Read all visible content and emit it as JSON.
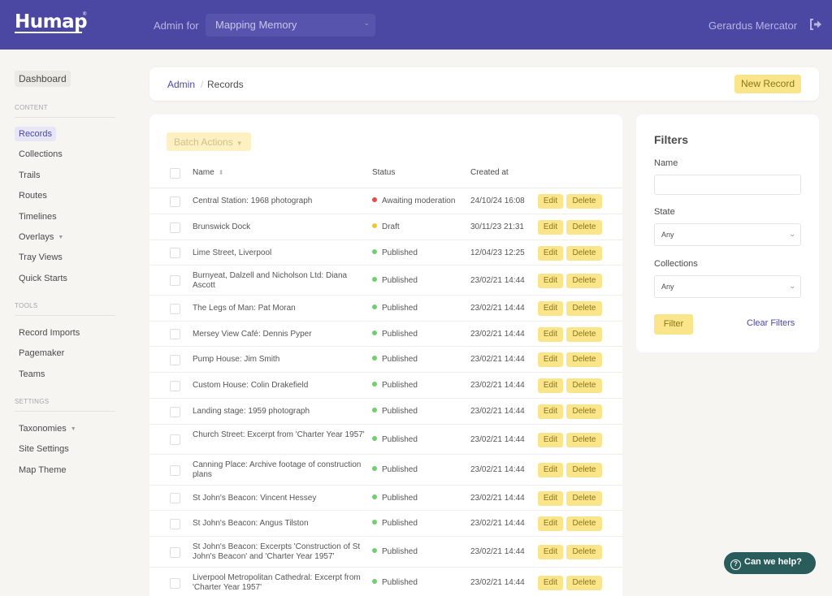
{
  "header": {
    "logo": "Humap",
    "logo_mark": "®",
    "admin_for_label": "Admin for",
    "site_select_value": "Mapping Memory",
    "user_name": "Gerardus Mercator",
    "logout_icon": "sign-out-icon"
  },
  "sidebar": {
    "dashboard": "Dashboard",
    "sections": [
      {
        "label": "CONTENT",
        "items": [
          {
            "label": "Records",
            "active": true
          },
          {
            "label": "Collections"
          },
          {
            "label": "Trails"
          },
          {
            "label": "Routes"
          },
          {
            "label": "Timelines"
          },
          {
            "label": "Overlays",
            "has_dropdown": true
          },
          {
            "label": "Tray Views"
          },
          {
            "label": "Quick Starts"
          }
        ]
      },
      {
        "label": "TOOLS",
        "items": [
          {
            "label": "Record Imports"
          },
          {
            "label": "Pagemaker"
          },
          {
            "label": "Teams"
          }
        ]
      },
      {
        "label": "SETTINGS",
        "items": [
          {
            "label": "Taxonomies",
            "has_dropdown": true
          },
          {
            "label": "Site Settings"
          },
          {
            "label": "Map Theme"
          }
        ]
      }
    ]
  },
  "breadcrumb": {
    "root": "Admin",
    "separator": "/",
    "current": "Records"
  },
  "new_record_label": "New Record",
  "table": {
    "batch_actions_label": "Batch Actions",
    "columns": {
      "name": "Name",
      "status": "Status",
      "created": "Created at"
    },
    "edit_label": "Edit",
    "delete_label": "Delete",
    "status_colors": {
      "Awaiting moderation": "#e54b4b",
      "Draft": "#f5c431",
      "Published": "#6fcf6f"
    },
    "rows": [
      {
        "name": "Central Station: 1968 photograph",
        "status": "Awaiting moderation",
        "created": "24/10/24 16:08"
      },
      {
        "name": "Brunswick Dock",
        "status": "Draft",
        "created": "30/11/23 21:31"
      },
      {
        "name": "Lime Street, Liverpool",
        "status": "Published",
        "created": "12/04/23 12:25"
      },
      {
        "name": "Burnyeat, Dalzell and Nicholson Ltd: Diana Ascott",
        "status": "Published",
        "created": "23/02/21 14:44"
      },
      {
        "name": "The Legs of Man: Pat Moran",
        "status": "Published",
        "created": "23/02/21 14:44"
      },
      {
        "name": "Mersey View Café: Dennis Pyper",
        "status": "Published",
        "created": "23/02/21 14:44"
      },
      {
        "name": "Pump House: Jim Smith",
        "status": "Published",
        "created": "23/02/21 14:44"
      },
      {
        "name": "Custom House: Colin Drakefield",
        "status": "Published",
        "created": "23/02/21 14:44"
      },
      {
        "name": "Landing stage: 1959 photograph",
        "status": "Published",
        "created": "23/02/21 14:44"
      },
      {
        "name": "Church Street: Excerpt from 'Charter Year 1957'",
        "status": "Published",
        "created": "23/02/21 14:44"
      },
      {
        "name": "Canning Place: Archive footage of construction plans",
        "status": "Published",
        "created": "23/02/21 14:44"
      },
      {
        "name": "St John's Beacon: Vincent Hessey",
        "status": "Published",
        "created": "23/02/21 14:44"
      },
      {
        "name": "St John's Beacon: Angus Tilston",
        "status": "Published",
        "created": "23/02/21 14:44"
      },
      {
        "name": "St John's Beacon: Excerpts 'Construction of St John's Beacon' and 'Charter Year 1957'",
        "status": "Published",
        "created": "23/02/21 14:44"
      },
      {
        "name": "Liverpool Metropolitan Cathedral: Excerpt from 'Charter Year 1957'",
        "status": "Published",
        "created": "23/02/21 14:44"
      }
    ]
  },
  "filters": {
    "title": "Filters",
    "name_label": "Name",
    "name_value": "",
    "state_label": "State",
    "state_value": "Any",
    "collections_label": "Collections",
    "collections_value": "Any",
    "filter_button": "Filter",
    "clear_link": "Clear Filters"
  },
  "help_button": "Can we help?"
}
